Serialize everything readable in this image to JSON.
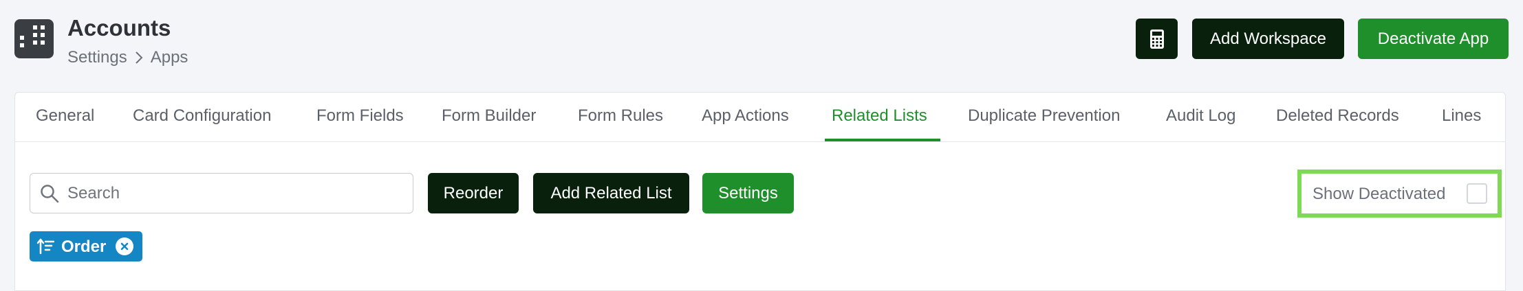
{
  "header": {
    "title": "Accounts",
    "breadcrumb": [
      "Settings",
      "Apps"
    ],
    "app_icon": "building-icon",
    "buttons": {
      "calculator_icon": "calculator-icon",
      "add_workspace": "Add Workspace",
      "deactivate_app": "Deactivate App"
    }
  },
  "tabs": [
    {
      "label": "General"
    },
    {
      "label": "Card Configuration"
    },
    {
      "label": "Form Fields"
    },
    {
      "label": "Form Builder"
    },
    {
      "label": "Form Rules"
    },
    {
      "label": "App Actions"
    },
    {
      "label": "Related Lists",
      "active": true
    },
    {
      "label": "Duplicate Prevention"
    },
    {
      "label": "Audit Log"
    },
    {
      "label": "Deleted Records"
    },
    {
      "label": "Lines"
    }
  ],
  "toolbar": {
    "search_placeholder": "Search",
    "search_value": "",
    "reorder": "Reorder",
    "add_related_list": "Add Related List",
    "settings": "Settings",
    "show_deactivated": "Show Deactivated",
    "show_deactivated_checked": false
  },
  "filters": {
    "order_chip": "Order"
  },
  "colors": {
    "accent_green": "#1f8f2c",
    "dark_button": "#08200c",
    "chip_blue": "#1586c4",
    "highlight": "#7ed957"
  }
}
